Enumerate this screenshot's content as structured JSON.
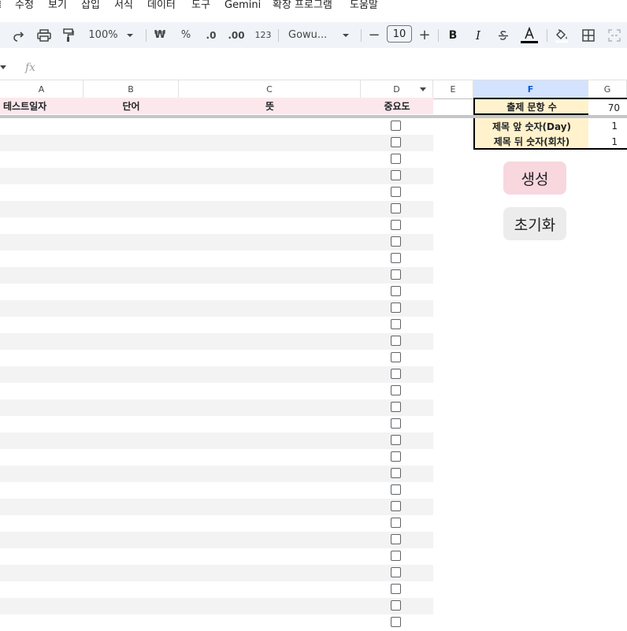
{
  "menu": [
    "수정",
    "보기",
    "삽입",
    "서식",
    "데이터",
    "도구",
    "Gemini",
    "확장 프로그램",
    "도움말"
  ],
  "toolbar": {
    "zoom": "100%",
    "currency": "₩",
    "percent": "%",
    "decrease_decimal": ".0",
    "increase_decimal": ".00",
    "number_format": "123",
    "font": "Gowu...",
    "font_size": "10",
    "minus": "−",
    "plus": "+",
    "bold": "B",
    "italic": "I"
  },
  "formula_bar": {
    "fx": "fx"
  },
  "columns": [
    "A",
    "B",
    "C",
    "D",
    "E",
    "F",
    "G"
  ],
  "header_row": {
    "test_date": "테스트일자",
    "word": "단어",
    "meaning": "뜻",
    "importance": "중요도"
  },
  "side_panel": {
    "question_count_label": "출제 문항 수",
    "question_count_value": "70",
    "title_prefix_label": "제목 앞 숫자(Day)",
    "title_prefix_value": "1",
    "title_suffix_label": "제목 뒤 숫자(회차)",
    "title_suffix_value": "1",
    "generate_button": "생성",
    "reset_button": "초기화"
  },
  "colors": {
    "header_bg": "#fce8ec",
    "side_cell_bg": "#fff2cc",
    "generate_bg": "#f8d7df",
    "reset_bg": "#ececec",
    "selected_column": "#d3e3fd"
  },
  "icons": [
    "redo-icon",
    "print-icon",
    "paint-format-icon",
    "zoom-dropdown-icon",
    "font-dropdown-icon",
    "strikethrough-icon",
    "text-color-icon",
    "fill-color-icon",
    "borders-icon",
    "merge-cells-icon",
    "checkbox-icon"
  ]
}
